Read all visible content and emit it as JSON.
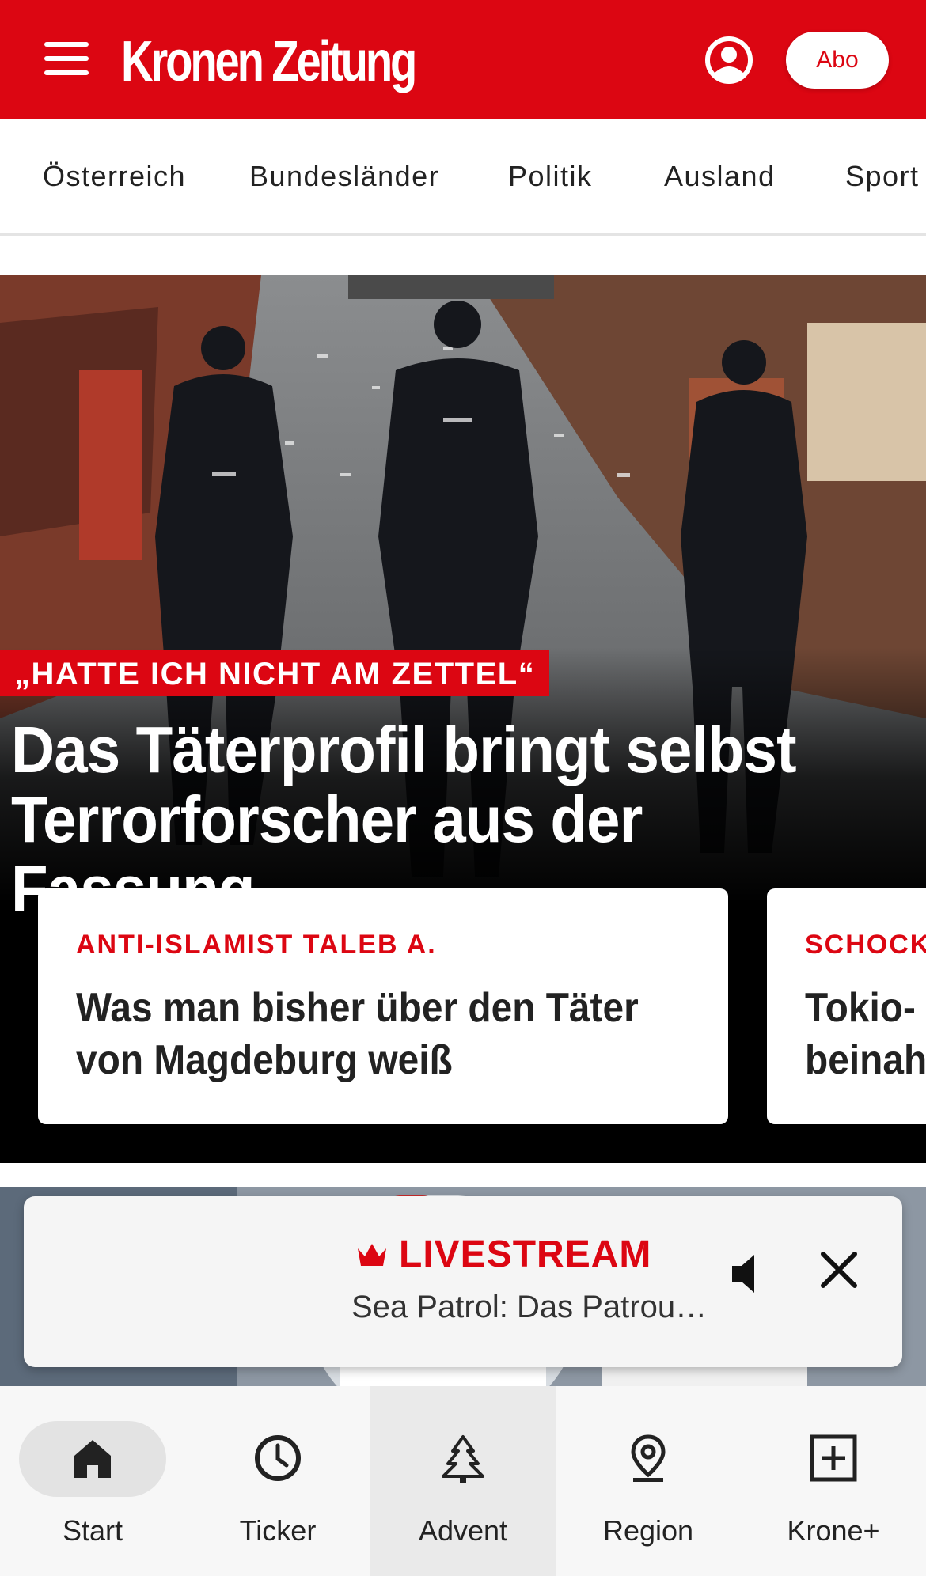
{
  "header": {
    "logo_text": "Kronen Zeitung",
    "abo_label": "Abo",
    "brand_color": "#dc0612",
    "menu_icon": "hamburger-menu-icon",
    "account_icon": "user-account-icon"
  },
  "categories": [
    "Österreich",
    "Bundesländer",
    "Politik",
    "Ausland",
    "Sport"
  ],
  "hero": {
    "image_description_icon": "police-photo",
    "kicker": "„HATTE ICH NICHT AM ZETTEL“",
    "headline": "Das Täterprofil bringt selbst Terrorforscher aus der Fassung"
  },
  "cards": [
    {
      "tag": "ANTI-ISLAMIST TALEB A.",
      "title": "Was man bisher über den Täter\nvon Magdeburg weiß"
    },
    {
      "tag": "SCHOCK",
      "title": "Tokio-\nbeinah"
    }
  ],
  "livestream": {
    "label": "LIVESTREAM",
    "title": "Sea Patrol: Das Patrou…",
    "crown_icon": "crown-icon",
    "mute_icon": "speaker-icon",
    "close_icon": "close-icon"
  },
  "bottom_nav": [
    {
      "label": "Start",
      "icon": "home-icon",
      "active": true
    },
    {
      "label": "Ticker",
      "icon": "clock-icon",
      "active": false
    },
    {
      "label": "Advent",
      "icon": "christmas-tree-icon",
      "active": false
    },
    {
      "label": "Region",
      "icon": "location-pin-icon",
      "active": false
    },
    {
      "label": "Krone+",
      "icon": "plus-box-icon",
      "active": false
    }
  ]
}
